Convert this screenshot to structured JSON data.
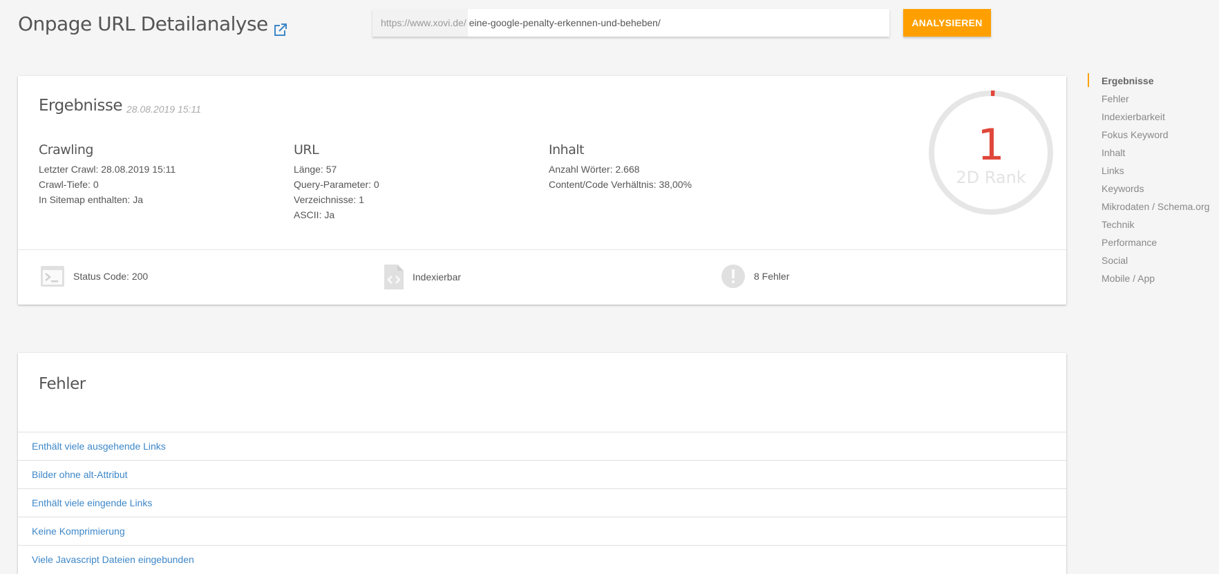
{
  "header": {
    "title": "Onpage URL Detailanalyse",
    "external_link_icon": "external-link-icon",
    "url_prefix": "https://www.xovi.de/",
    "url_value": "eine-google-penalty-erkennen-und-beheben/",
    "analyze_label": "ANALYSIEREN"
  },
  "results": {
    "title": "Ergebnisse",
    "date": "28.08.2019 15:11",
    "crawling": {
      "heading": "Crawling",
      "lines": [
        "Letzter Crawl: 28.08.2019 15:11",
        "Crawl-Tiefe: 0",
        "In Sitemap enthalten: Ja"
      ]
    },
    "url": {
      "heading": "URL",
      "lines": [
        "Länge: 57",
        "Query-Parameter: 0",
        "Verzeichnisse: 1",
        "ASCII: Ja"
      ]
    },
    "inhalt": {
      "heading": "Inhalt",
      "lines": [
        "Anzahl Wörter: 2.668",
        "Content/Code Verhältnis: 38,00%"
      ]
    },
    "rank": {
      "value": "1",
      "label": "2D Rank",
      "fill_fraction": 0.01,
      "color": "#e0473b",
      "track_color": "#e6e6e6"
    },
    "status": {
      "status_code": "Status Code: 200",
      "indexable": "Indexierbar",
      "errors": "8 Fehler"
    }
  },
  "errors": {
    "title": "Fehler",
    "items": [
      "Enthält viele ausgehende Links",
      "Bilder ohne alt-Attribut",
      "Enthält viele eingende Links",
      "Keine Komprimierung",
      "Viele Javascript Dateien eingebunden"
    ]
  },
  "sidebar": {
    "items": [
      {
        "label": "Ergebnisse",
        "active": true
      },
      {
        "label": "Fehler"
      },
      {
        "label": "Indexierbarkeit"
      },
      {
        "label": "Fokus Keyword"
      },
      {
        "label": "Inhalt"
      },
      {
        "label": "Links"
      },
      {
        "label": "Keywords"
      },
      {
        "label": "Mikrodaten / Schema.org"
      },
      {
        "label": "Technik"
      },
      {
        "label": "Performance"
      },
      {
        "label": "Social"
      },
      {
        "label": "Mobile / App"
      }
    ]
  },
  "colors": {
    "accent": "#ffa000",
    "link": "#3d87c8",
    "rank": "#e0473b"
  }
}
